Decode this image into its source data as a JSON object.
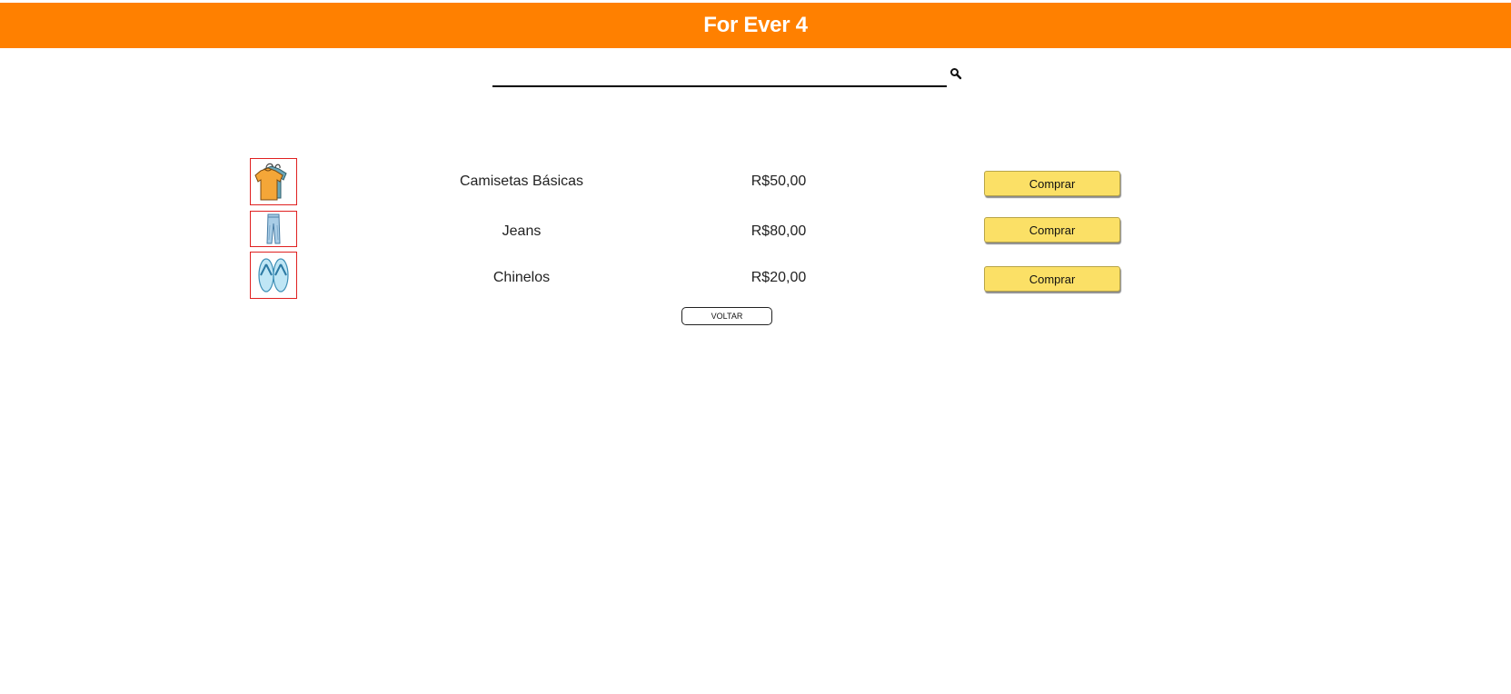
{
  "header": {
    "title": "For Ever 4",
    "color": "#ff8000"
  },
  "search": {
    "value": "",
    "placeholder": "",
    "button_icon": "search-icon"
  },
  "products": [
    {
      "icon": "tshirt-icon",
      "name": "Camisetas Básicas",
      "price": "R$50,00",
      "buy_label": "Comprar"
    },
    {
      "icon": "jeans-icon",
      "name": "Jeans",
      "price": "R$80,00",
      "buy_label": "Comprar"
    },
    {
      "icon": "flip-flops-icon",
      "name": "Chinelos",
      "price": "R$20,00",
      "buy_label": "Comprar"
    }
  ],
  "back_label": "VOLTAR",
  "colors": {
    "button_yellow": "#fbe066",
    "thumb_border": "#e02020"
  }
}
